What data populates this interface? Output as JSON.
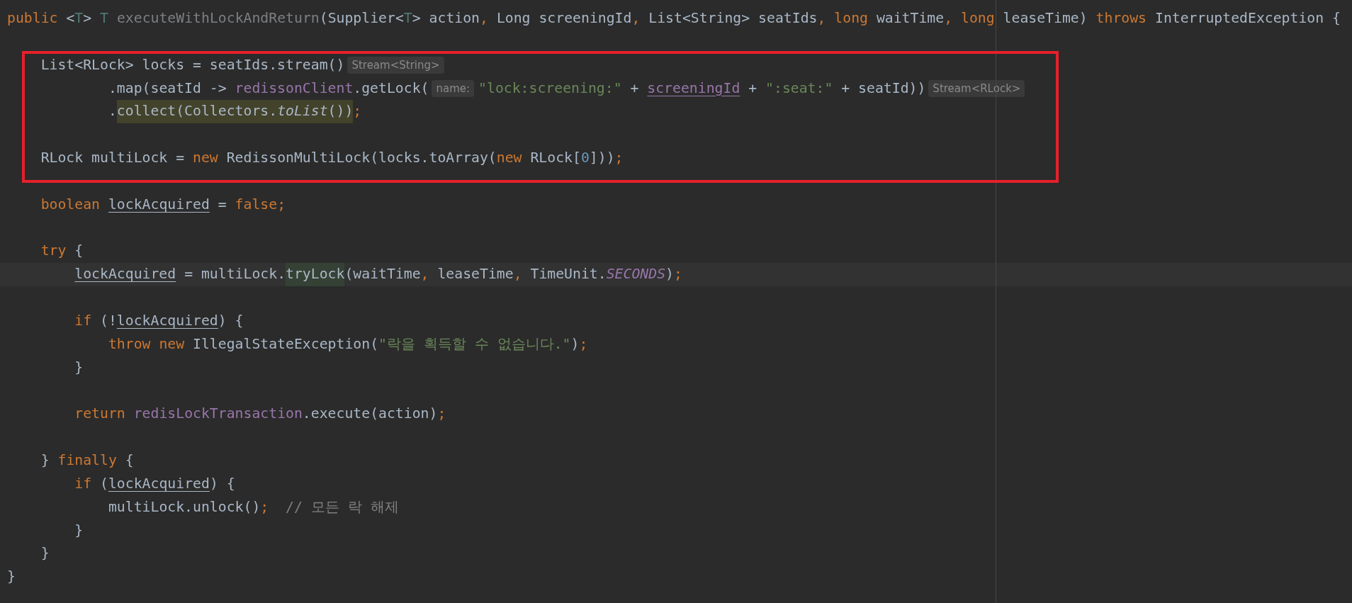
{
  "editor": {
    "blocks": [
      {
        "kind": "plain",
        "lines": [
          {
            "kind": "code",
            "tokens": [
              {
                "text": "public",
                "kind": "kw"
              },
              {
                "text": " <",
                "kind": "plain"
              },
              {
                "text": "T",
                "kind": "param"
              },
              {
                "text": "> ",
                "kind": "plain"
              },
              {
                "text": "T",
                "kind": "param"
              },
              {
                "text": " executeWithLockAndReturn",
                "kind": "dim"
              },
              {
                "text": "(Supplier<",
                "kind": "plain"
              },
              {
                "text": "T",
                "kind": "param"
              },
              {
                "text": "> action",
                "kind": "plain"
              },
              {
                "text": ",",
                "kind": "kw"
              },
              {
                "text": " Long screeningId",
                "kind": "plain"
              },
              {
                "text": ",",
                "kind": "kw"
              },
              {
                "text": " List<String> seatIds",
                "kind": "plain"
              },
              {
                "text": ",",
                "kind": "kw"
              },
              {
                "text": " long",
                "kind": "kw"
              },
              {
                "text": " waitTime",
                "kind": "plain"
              },
              {
                "text": ",",
                "kind": "kw"
              },
              {
                "text": " long",
                "kind": "kw"
              },
              {
                "text": " leaseTime) ",
                "kind": "plain"
              },
              {
                "text": "throws",
                "kind": "kw"
              },
              {
                "text": " InterruptedException {",
                "kind": "plain"
              }
            ]
          },
          {
            "kind": "blank"
          }
        ]
      },
      {
        "kind": "annotated",
        "lines": [
          {
            "kind": "code",
            "tokens": [
              {
                "text": "    List<RLock> locks = seatIds.stream()",
                "kind": "plain"
              },
              {
                "text": "Stream<String>",
                "kind": "hint"
              }
            ]
          },
          {
            "kind": "code",
            "tokens": [
              {
                "text": "            .map(seatId -> ",
                "kind": "plain"
              },
              {
                "text": "redissonClient",
                "kind": "field"
              },
              {
                "text": ".getLock(",
                "kind": "plain"
              },
              {
                "text": "name:",
                "kind": "hint"
              },
              {
                "text": "\"lock:screening:\"",
                "kind": "str"
              },
              {
                "text": " + ",
                "kind": "plain"
              },
              {
                "text": "screeningId",
                "kind": "field_u"
              },
              {
                "text": " + ",
                "kind": "plain"
              },
              {
                "text": "\":seat:\"",
                "kind": "str"
              },
              {
                "text": " + seatId))",
                "kind": "plain"
              },
              {
                "text": "Stream<RLock>",
                "kind": "hint"
              }
            ]
          },
          {
            "kind": "code",
            "tokens": [
              {
                "text": "            .",
                "kind": "plain"
              },
              {
                "kind": "highlight",
                "tokens": [
                  {
                    "text": "collect(Collectors.",
                    "kind": "plain"
                  },
                  {
                    "text": "toList",
                    "kind": "italic"
                  },
                  {
                    "text": "())",
                    "kind": "plain"
                  }
                ]
              },
              {
                "text": ";",
                "kind": "kw"
              }
            ]
          },
          {
            "kind": "blank"
          },
          {
            "kind": "code",
            "tokens": [
              {
                "text": "    RLock multiLock = ",
                "kind": "plain"
              },
              {
                "text": "new",
                "kind": "kw"
              },
              {
                "text": " RedissonMultiLock(locks.toArray(",
                "kind": "plain"
              },
              {
                "text": "new",
                "kind": "kw"
              },
              {
                "text": " RLock[",
                "kind": "plain"
              },
              {
                "text": "0",
                "kind": "num"
              },
              {
                "text": "]))",
                "kind": "plain"
              },
              {
                "text": ";",
                "kind": "kw"
              }
            ]
          }
        ]
      },
      {
        "kind": "plain",
        "lines": [
          {
            "kind": "blank"
          },
          {
            "kind": "code",
            "tokens": [
              {
                "text": "    boolean",
                "kind": "kw"
              },
              {
                "text": " lockAcquired",
                "kind": "var_u"
              },
              {
                "text": " = ",
                "kind": "plain"
              },
              {
                "text": "false;",
                "kind": "kw"
              }
            ]
          },
          {
            "kind": "blank"
          },
          {
            "kind": "code",
            "tokens": [
              {
                "text": "    try",
                "kind": "kw"
              },
              {
                "text": " {",
                "kind": "plain"
              }
            ]
          }
        ]
      },
      {
        "kind": "current",
        "lines": [
          {
            "kind": "code",
            "tokens": [
              {
                "text": "        lockAcquired",
                "kind": "var_u"
              },
              {
                "text": " = multiLock.",
                "kind": "plain"
              },
              {
                "kind": "highlight",
                "tokens": [
                  {
                    "text": "tryLock",
                    "kind": "plain"
                  }
                ]
              },
              {
                "text": "(waitTime",
                "kind": "plain"
              },
              {
                "text": ",",
                "kind": "kw"
              },
              {
                "text": " leaseTime",
                "kind": "plain"
              },
              {
                "text": ",",
                "kind": "kw"
              },
              {
                "text": " TimeUnit.",
                "kind": "plain"
              },
              {
                "text": "SECONDS",
                "kind": "const"
              },
              {
                "text": ")",
                "kind": "plain"
              },
              {
                "text": ";",
                "kind": "kw"
              }
            ]
          }
        ]
      },
      {
        "kind": "plain",
        "lines": [
          {
            "kind": "blank"
          },
          {
            "kind": "code",
            "tokens": [
              {
                "text": "        if",
                "kind": "kw"
              },
              {
                "text": " (!",
                "kind": "plain"
              },
              {
                "text": "lockAcquired",
                "kind": "var_u"
              },
              {
                "text": ") {",
                "kind": "plain"
              }
            ]
          },
          {
            "kind": "code",
            "tokens": [
              {
                "text": "            throw new",
                "kind": "kw"
              },
              {
                "text": " IllegalStateException(",
                "kind": "plain"
              },
              {
                "text": "\"락을 획득할 수 없습니다.\"",
                "kind": "str"
              },
              {
                "text": ")",
                "kind": "plain"
              },
              {
                "text": ";",
                "kind": "kw"
              }
            ]
          },
          {
            "kind": "code",
            "tokens": [
              {
                "text": "        }",
                "kind": "plain"
              }
            ]
          },
          {
            "kind": "blank"
          },
          {
            "kind": "code",
            "tokens": [
              {
                "text": "        return",
                "kind": "kw"
              },
              {
                "text": " redisLockTransaction",
                "kind": "field"
              },
              {
                "text": ".execute(action)",
                "kind": "plain"
              },
              {
                "text": ";",
                "kind": "kw"
              }
            ]
          },
          {
            "kind": "blank"
          },
          {
            "kind": "code",
            "tokens": [
              {
                "text": "    }",
                "kind": "plain"
              },
              {
                "text": " finally",
                "kind": "kw"
              },
              {
                "text": " {",
                "kind": "plain"
              }
            ]
          },
          {
            "kind": "code",
            "tokens": [
              {
                "text": "        if",
                "kind": "kw"
              },
              {
                "text": " (",
                "kind": "plain"
              },
              {
                "text": "lockAcquired",
                "kind": "var_u"
              },
              {
                "text": ") {",
                "kind": "plain"
              }
            ]
          },
          {
            "kind": "code",
            "tokens": [
              {
                "text": "            multiLock.unlock()",
                "kind": "plain"
              },
              {
                "text": ";",
                "kind": "kw"
              },
              {
                "text": "  // 모든 락 해제",
                "kind": "comment"
              }
            ]
          },
          {
            "kind": "code",
            "tokens": [
              {
                "text": "        }",
                "kind": "plain"
              }
            ]
          },
          {
            "kind": "code",
            "tokens": [
              {
                "text": "    }",
                "kind": "plain"
              }
            ]
          },
          {
            "kind": "code",
            "tokens": [
              {
                "text": "}",
                "kind": "plain"
              }
            ]
          }
        ]
      }
    ]
  }
}
